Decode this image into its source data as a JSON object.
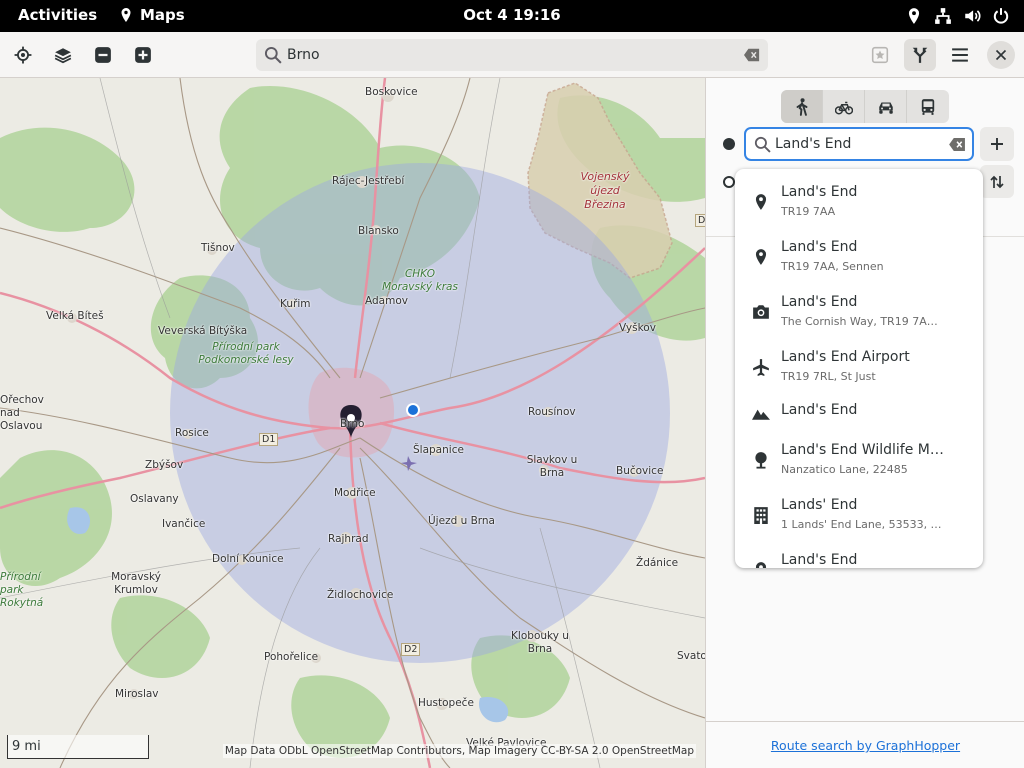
{
  "topbar": {
    "activities": "Activities",
    "app_name": "Maps",
    "clock": "Oct 4  19:16",
    "status_icons": [
      "location-icon",
      "network-icon",
      "volume-icon",
      "power-icon"
    ]
  },
  "header": {
    "search_value": "Brno",
    "buttons": [
      "locate-icon",
      "layers-icon",
      "zoom-out-icon",
      "zoom-in-icon",
      "favorites-icon",
      "route-icon",
      "menu-icon",
      "close-icon"
    ]
  },
  "map": {
    "places": [
      "Boskovice",
      "Vojenský újezd Březina",
      "Rájec-Jestřebí",
      "Blansko",
      "CHKO Moravský kras",
      "Tišnov",
      "Kuřim",
      "Adamov",
      "Vyškov",
      "Velká Bíteš",
      "Veverská Bítýška",
      "Přírodní park Podkomorské lesy",
      "Rousínov",
      "Rosice",
      "Brno",
      "Šlapanice",
      "Slavkov u Brna",
      "Bučovice",
      "Zbýšov",
      "Oslavany",
      "Modřice",
      "Ivančice",
      "Újezd u Brna",
      "Rajhrad",
      "Dolní Kounice",
      "Ždánice",
      "Přírodní park Rokytná",
      "Moravský Krumlov",
      "Židlochovice",
      "Klobouky u Brna",
      "Pohořelice",
      "Svatob",
      "Miroslav",
      "Hustopeče",
      "Velké Pavlovice",
      "Ořechov nad Oslavou"
    ],
    "road_labels": [
      "D1",
      "D2",
      "D"
    ],
    "scale": "9 mi",
    "attribution": "Map Data ODbL OpenStreetMap Contributors, Map Imagery CC-BY-SA 2.0 OpenStreetMap",
    "colors": {
      "radius": "#9ea8e2",
      "forest": "#a9cf94",
      "military": "#d9d0b2",
      "accent": "#1c71d8"
    }
  },
  "sidebar": {
    "modes": [
      "walking-icon",
      "cycling-icon",
      "car-icon",
      "transit-icon"
    ],
    "selected_mode": "walking",
    "from_value": "Land's End",
    "add_icon": "add-icon",
    "swap_icon": "swap-icon",
    "footer_link": "Route search by GraphHopper"
  },
  "suggestions": [
    {
      "title": "Land's End",
      "subtitle": "TR19 7AA",
      "icon": "place-icon"
    },
    {
      "title": "Land's End",
      "subtitle": "TR19 7AA, Sennen",
      "icon": "place-icon"
    },
    {
      "title": "Land's End",
      "subtitle": "The Cornish Way, TR19 7A…",
      "icon": "camera-icon"
    },
    {
      "title": "Land's End Airport",
      "subtitle": "TR19 7RL, St Just",
      "icon": "airplane-icon"
    },
    {
      "title": "Land's End",
      "subtitle": "",
      "icon": "mountain-icon"
    },
    {
      "title": "Land's End Wildlife M…",
      "subtitle": "Nanzatico Lane, 22485",
      "icon": "tree-icon"
    },
    {
      "title": "Lands' End",
      "subtitle": "1 Lands' End Lane, 53533, …",
      "icon": "building-icon"
    },
    {
      "title": "Land's End",
      "subtitle": "",
      "icon": "place-icon"
    }
  ]
}
